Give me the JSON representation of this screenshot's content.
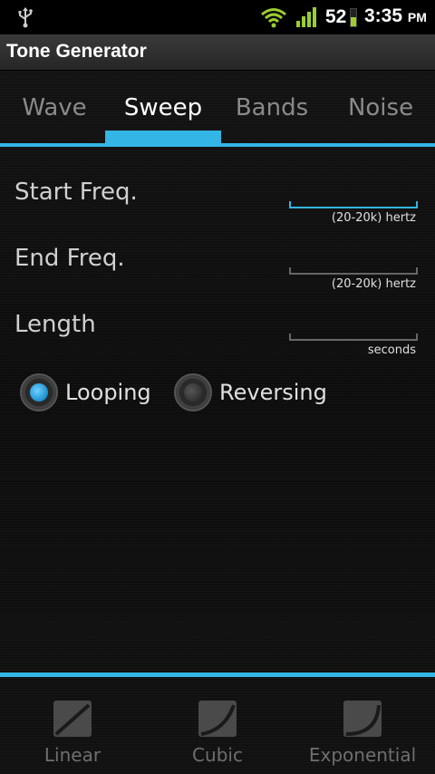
{
  "status_bar": {
    "battery_percent": "52",
    "battery_level": 0.52,
    "time": "3:35",
    "ampm": "PM"
  },
  "app": {
    "title": "Tone Generator"
  },
  "tabs": [
    {
      "label": "Wave",
      "active": false
    },
    {
      "label": "Sweep",
      "active": true
    },
    {
      "label": "Bands",
      "active": false
    },
    {
      "label": "Noise",
      "active": false
    }
  ],
  "form": {
    "start_freq": {
      "label": "Start Freq.",
      "value": "",
      "hint": "(20-20k) hertz"
    },
    "end_freq": {
      "label": "End Freq.",
      "value": "",
      "hint": "(20-20k) hertz"
    },
    "length": {
      "label": "Length",
      "value": "",
      "hint": "seconds"
    },
    "looping": {
      "label": "Looping",
      "checked": true
    },
    "reversing": {
      "label": "Reversing",
      "checked": false
    }
  },
  "curves": [
    {
      "label": "Linear"
    },
    {
      "label": "Cubic"
    },
    {
      "label": "Exponential"
    }
  ],
  "colors": {
    "accent": "#33b5e5",
    "wifi": "#9acd32",
    "background": "#0b0b0b"
  }
}
